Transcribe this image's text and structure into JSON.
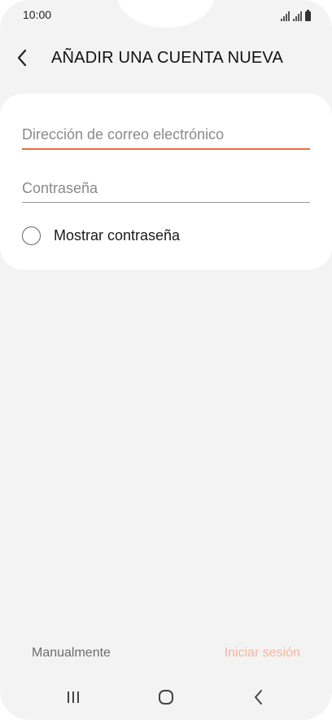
{
  "status_bar": {
    "time": "10:00"
  },
  "header": {
    "title": "AÑADIR UNA CUENTA NUEVA",
    "back_icon": "chevron-left-icon"
  },
  "form": {
    "email": {
      "value": "",
      "placeholder": "Dirección de correo electrónico"
    },
    "password": {
      "value": "",
      "placeholder": "Contraseña"
    },
    "show_password_label": "Mostrar contraseña",
    "show_password_checked": false
  },
  "actions": {
    "manual_label": "Manualmente",
    "login_label": "Iniciar sesión"
  },
  "navigation": {
    "recents_icon": "recents-icon",
    "home_icon": "home-icon",
    "back_icon": "back-icon"
  },
  "colors": {
    "accent": "#e8703c",
    "disabled_accent": "#f3b6a0",
    "background": "#f3f3f3",
    "card": "#ffffff"
  }
}
